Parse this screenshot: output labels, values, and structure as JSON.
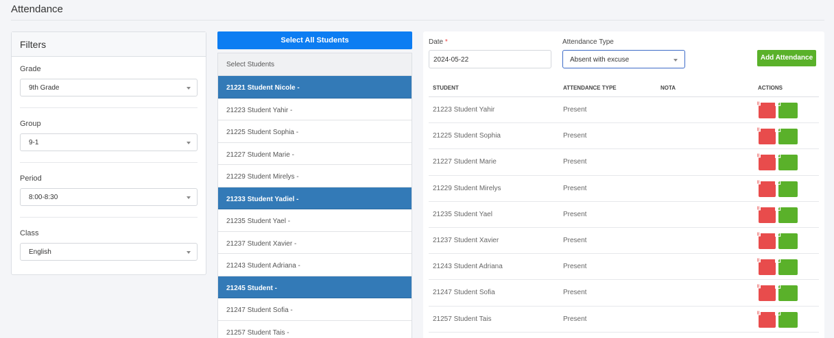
{
  "page": {
    "title": "Attendance"
  },
  "filters": {
    "title": "Filters",
    "grade": {
      "label": "Grade",
      "value": "9th Grade"
    },
    "group": {
      "label": "Group",
      "value": "9-1"
    },
    "period": {
      "label": "Period",
      "value": "8:00-8:30"
    },
    "class": {
      "label": "Class",
      "value": "English"
    }
  },
  "students": {
    "select_all_label": "Select All Students",
    "list_header": "Select Students",
    "items": [
      {
        "label": "21221 Student Nicole -",
        "selected": true
      },
      {
        "label": "21223 Student Yahir -",
        "selected": false
      },
      {
        "label": "21225 Student Sophia -",
        "selected": false
      },
      {
        "label": "21227 Student Marie -",
        "selected": false
      },
      {
        "label": "21229 Student Mirelys -",
        "selected": false
      },
      {
        "label": "21233 Student Yadiel -",
        "selected": true
      },
      {
        "label": "21235 Student Yael -",
        "selected": false
      },
      {
        "label": "21237 Student Xavier -",
        "selected": false
      },
      {
        "label": "21243 Student Adriana -",
        "selected": false
      },
      {
        "label": "21245 Student -",
        "selected": true
      },
      {
        "label": "21247 Student Sofia -",
        "selected": false
      },
      {
        "label": "21257 Student Tais -",
        "selected": false
      }
    ]
  },
  "attendance_form": {
    "date_label": "Date",
    "date_required_mark": "*",
    "date_value": "2024-05-22",
    "type_label": "Attendance Type",
    "type_value": "Absent with excuse",
    "add_button_label": "Add Attendance"
  },
  "attendance_table": {
    "headers": {
      "student": "STUDENT",
      "type": "ATTENDANCE TYPE",
      "nota": "NOTA",
      "actions": "ACTIONS"
    },
    "rows": [
      {
        "student": "21223 Student Yahir",
        "type": "Present",
        "nota": ""
      },
      {
        "student": "21225 Student Sophia",
        "type": "Present",
        "nota": ""
      },
      {
        "student": "21227 Student Marie",
        "type": "Present",
        "nota": ""
      },
      {
        "student": "21229 Student Mirelys",
        "type": "Present",
        "nota": ""
      },
      {
        "student": "21235 Student Yael",
        "type": "Present",
        "nota": ""
      },
      {
        "student": "21237 Student Xavier",
        "type": "Present",
        "nota": ""
      },
      {
        "student": "21243 Student Adriana",
        "type": "Present",
        "nota": ""
      },
      {
        "student": "21247 Student Sofia",
        "type": "Present",
        "nota": ""
      },
      {
        "student": "21257 Student Tais",
        "type": "Present",
        "nota": ""
      }
    ]
  },
  "colors": {
    "primary": "#0d7df2",
    "selected_row": "#337ab7",
    "success": "#5ab12a",
    "danger": "#e84c4c"
  },
  "icons": {
    "delete": "trash-icon",
    "edit": "edit-icon",
    "dropdown": "caret-down-icon"
  }
}
